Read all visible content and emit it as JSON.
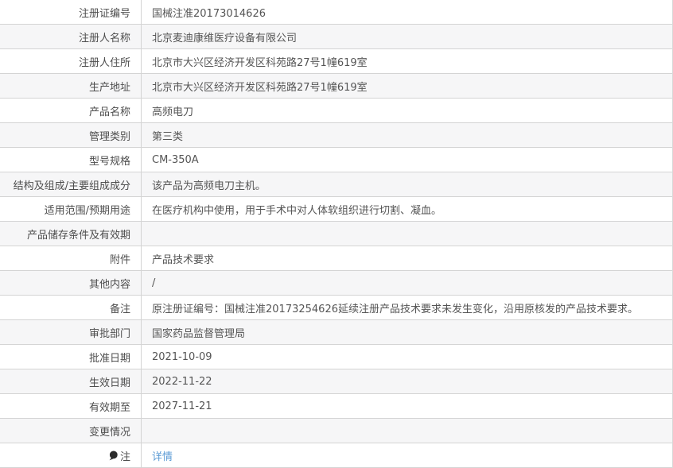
{
  "colors": {
    "link_blue": "#5b9bd5",
    "stripe_gray": "#f6f6f7",
    "border_gray": "#d4d4d4",
    "label_text": "#4d4d4d",
    "value_text": "#555555",
    "note_icon_dark": "#2b2b2b"
  },
  "table": {
    "rows": [
      {
        "label": "注册证编号",
        "value": "国械注准20173014626"
      },
      {
        "label": "注册人名称",
        "value": "北京麦迪康维医疗设备有限公司"
      },
      {
        "label": "注册人住所",
        "value": "北京市大兴区经济开发区科苑路27号1幢619室"
      },
      {
        "label": "生产地址",
        "value": "北京市大兴区经济开发区科苑路27号1幢619室"
      },
      {
        "label": "产品名称",
        "value": "高频电刀"
      },
      {
        "label": "管理类别",
        "value": "第三类"
      },
      {
        "label": "型号规格",
        "value": "CM-350A"
      },
      {
        "label": "结构及组成/主要组成成分",
        "value": "该产品为高频电刀主机。"
      },
      {
        "label": "适用范围/预期用途",
        "value": "在医疗机构中使用，用于手术中对人体软组织进行切割、凝血。"
      },
      {
        "label": "产品储存条件及有效期",
        "value": ""
      },
      {
        "label": "附件",
        "value": "产品技术要求"
      },
      {
        "label": "其他内容",
        "value": "/"
      },
      {
        "label": "备注",
        "value": "原注册证编号：国械注准20173254626延续注册产品技术要求未发生变化，沿用原核发的产品技术要求。"
      },
      {
        "label": "审批部门",
        "value": "国家药品监督管理局"
      },
      {
        "label": "批准日期",
        "value": "2021-10-09"
      },
      {
        "label": "生效日期",
        "value": "2022-11-22"
      },
      {
        "label": "有效期至",
        "value": "2027-11-21"
      },
      {
        "label": "变更情况",
        "value": ""
      },
      {
        "label": "注",
        "value": "详情",
        "icon": "speech-bubble-icon",
        "link": true
      }
    ]
  }
}
